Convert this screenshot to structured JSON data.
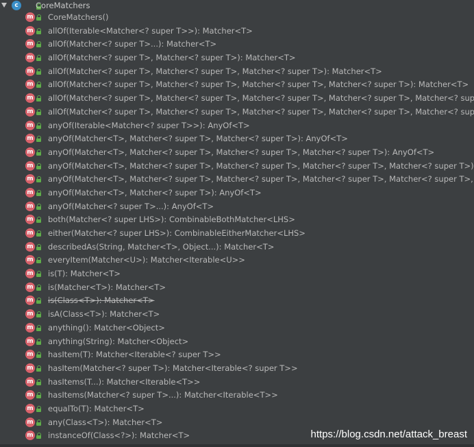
{
  "root": {
    "class_icon_letter": "c",
    "label": "CoreMatchers"
  },
  "method_icon_letter": "m",
  "members": [
    {
      "label": "CoreMatchers()",
      "deprecated": false
    },
    {
      "label": "allOf(Iterable<Matcher<? super T>>): Matcher<T>",
      "deprecated": false
    },
    {
      "label": "allOf(Matcher<? super T>...): Matcher<T>",
      "deprecated": false
    },
    {
      "label": "allOf(Matcher<? super T>, Matcher<? super T>): Matcher<T>",
      "deprecated": false
    },
    {
      "label": "allOf(Matcher<? super T>, Matcher<? super T>, Matcher<? super T>): Matcher<T>",
      "deprecated": false
    },
    {
      "label": "allOf(Matcher<? super T>, Matcher<? super T>, Matcher<? super T>, Matcher<? super T>): Matcher<T>",
      "deprecated": false
    },
    {
      "label": "allOf(Matcher<? super T>, Matcher<? super T>, Matcher<? super T>, Matcher<? super T>, Matcher<? super",
      "deprecated": false
    },
    {
      "label": "allOf(Matcher<? super T>, Matcher<? super T>, Matcher<? super T>, Matcher<? super T>, Matcher<? super",
      "deprecated": false
    },
    {
      "label": "anyOf(Iterable<Matcher<? super T>>): AnyOf<T>",
      "deprecated": false
    },
    {
      "label": "anyOf(Matcher<T>, Matcher<? super T>, Matcher<? super T>): AnyOf<T>",
      "deprecated": false
    },
    {
      "label": "anyOf(Matcher<T>, Matcher<? super T>, Matcher<? super T>, Matcher<? super T>): AnyOf<T>",
      "deprecated": false
    },
    {
      "label": "anyOf(Matcher<T>, Matcher<? super T>, Matcher<? super T>, Matcher<? super T>, Matcher<? super T>): A",
      "deprecated": false
    },
    {
      "label": "anyOf(Matcher<T>, Matcher<? super T>, Matcher<? super T>, Matcher<? super T>, Matcher<? super T>, M",
      "deprecated": false
    },
    {
      "label": "anyOf(Matcher<T>, Matcher<? super T>): AnyOf<T>",
      "deprecated": false
    },
    {
      "label": "anyOf(Matcher<? super T>...): AnyOf<T>",
      "deprecated": false
    },
    {
      "label": "both(Matcher<? super LHS>): CombinableBothMatcher<LHS>",
      "deprecated": false
    },
    {
      "label": "either(Matcher<? super LHS>): CombinableEitherMatcher<LHS>",
      "deprecated": false
    },
    {
      "label": "describedAs(String, Matcher<T>, Object...): Matcher<T>",
      "deprecated": false
    },
    {
      "label": "everyItem(Matcher<U>): Matcher<Iterable<U>>",
      "deprecated": false
    },
    {
      "label": "is(T): Matcher<T>",
      "deprecated": false
    },
    {
      "label": "is(Matcher<T>): Matcher<T>",
      "deprecated": false
    },
    {
      "label": "is(Class<T>): Matcher<T>",
      "deprecated": true
    },
    {
      "label": "isA(Class<T>): Matcher<T>",
      "deprecated": false
    },
    {
      "label": "anything(): Matcher<Object>",
      "deprecated": false
    },
    {
      "label": "anything(String): Matcher<Object>",
      "deprecated": false
    },
    {
      "label": "hasItem(T): Matcher<Iterable<? super T>>",
      "deprecated": false
    },
    {
      "label": "hasItem(Matcher<? super T>): Matcher<Iterable<? super T>>",
      "deprecated": false
    },
    {
      "label": "hasItems(T...): Matcher<Iterable<T>>",
      "deprecated": false
    },
    {
      "label": "hasItems(Matcher<? super T>...): Matcher<Iterable<T>>",
      "deprecated": false
    },
    {
      "label": "equalTo(T): Matcher<T>",
      "deprecated": false
    },
    {
      "label": "any(Class<T>): Matcher<T>",
      "deprecated": false
    },
    {
      "label": "instanceOf(Class<?>): Matcher<T>",
      "deprecated": false
    }
  ],
  "watermark": "https://blog.csdn.net/attack_breast",
  "colors": {
    "background": "#3c3f41",
    "class_icon": "#3a8fc8",
    "method_icon": "#d8626b",
    "lock_icon": "#5fae4a"
  }
}
